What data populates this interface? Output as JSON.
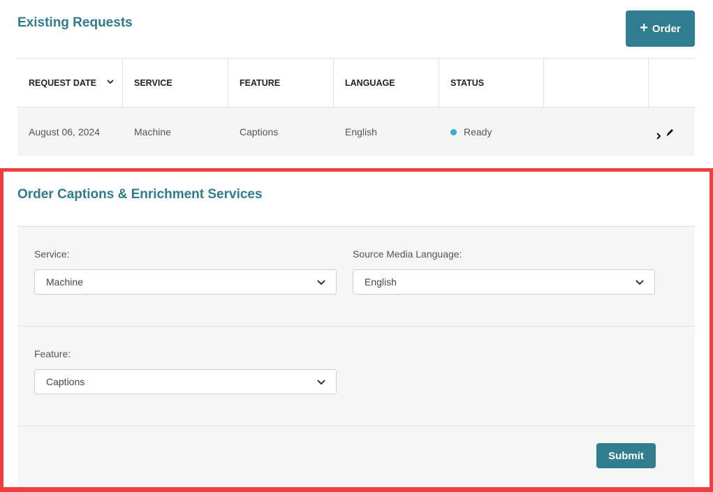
{
  "existing_requests": {
    "title": "Existing Requests",
    "order_button": {
      "icon": "plus-icon",
      "label": "Order"
    },
    "columns": [
      "REQUEST DATE",
      "SERVICE",
      "FEATURE",
      "LANGUAGE",
      "STATUS"
    ],
    "rows": [
      {
        "request_date": "August 06, 2024",
        "service": "Machine",
        "feature": "Captions",
        "language": "English",
        "status": "Ready",
        "status_color": "#3aaad4"
      }
    ]
  },
  "order_form": {
    "title": "Order Captions & Enrichment Services",
    "service": {
      "label": "Service:",
      "value": "Machine"
    },
    "source_language": {
      "label": "Source Media Language:",
      "value": "English"
    },
    "feature": {
      "label": "Feature:",
      "value": "Captions"
    },
    "submit_label": "Submit"
  },
  "colors": {
    "accent": "#2f7d8f",
    "title": "#2e7b8f",
    "highlight_border": "#f03e41"
  }
}
